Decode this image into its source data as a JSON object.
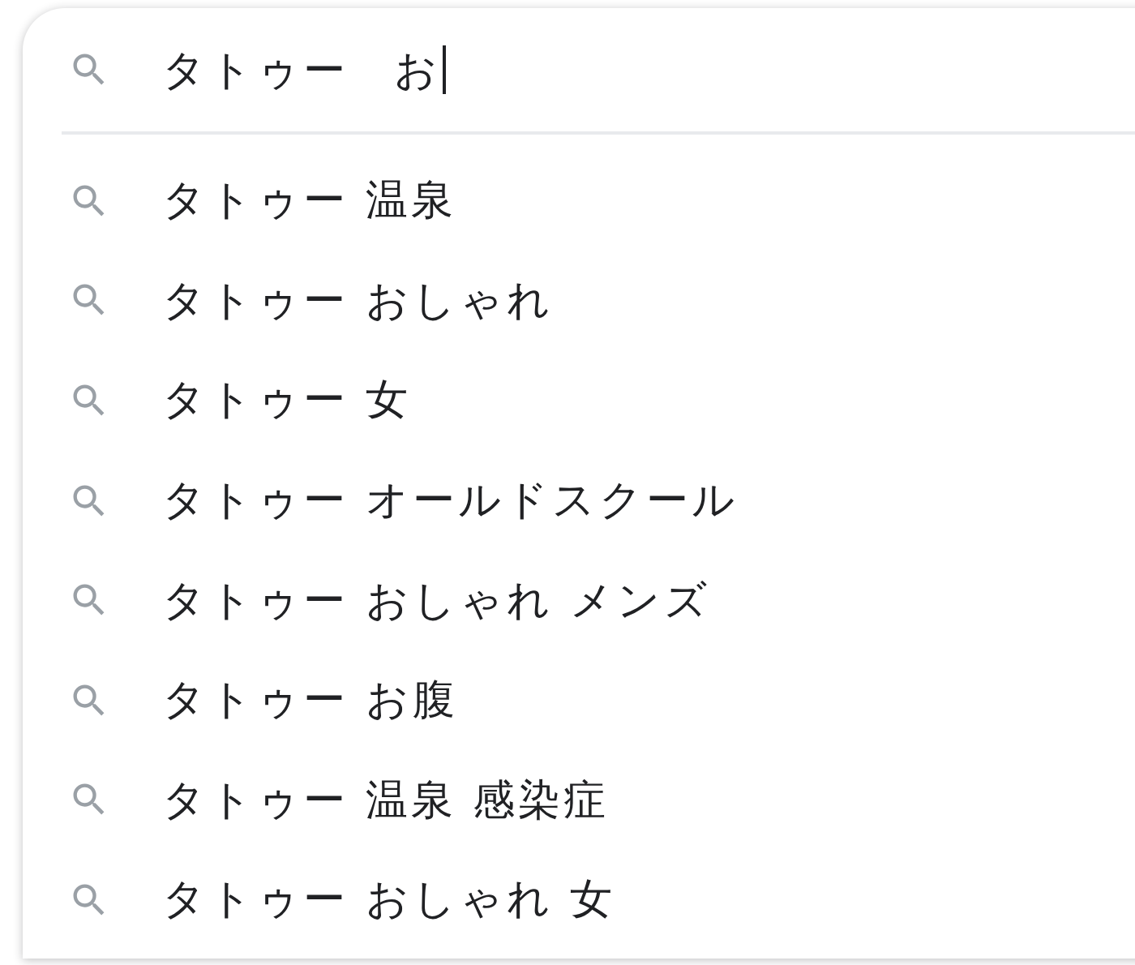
{
  "search": {
    "value": "タトゥー　お"
  },
  "suggestions": [
    {
      "text": "タトゥー 温泉"
    },
    {
      "text": "タトゥー おしゃれ"
    },
    {
      "text": "タトゥー 女"
    },
    {
      "text": "タトゥー オールドスクール"
    },
    {
      "text": "タトゥー おしゃれ メンズ"
    },
    {
      "text": "タトゥー お腹"
    },
    {
      "text": "タトゥー 温泉 感染症"
    },
    {
      "text": "タトゥー おしゃれ 女"
    }
  ]
}
